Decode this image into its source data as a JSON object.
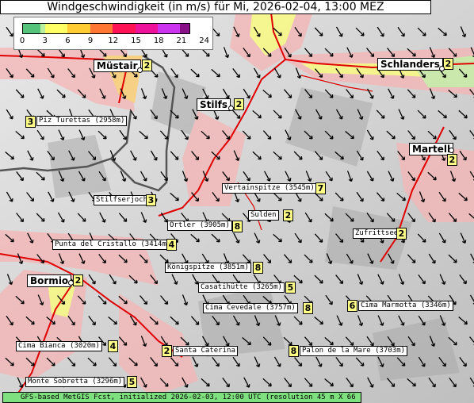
{
  "title": "Windgeschwindigkeit (in m/s) für Mi, 2026-02-04, 13:00 MEZ",
  "legend": {
    "colors": [
      "#55c47a",
      "#b9f0a0",
      "#ffff66",
      "#ffcc33",
      "#ff7733",
      "#ff1155",
      "#ee1199",
      "#cc33ee",
      "#881188"
    ],
    "ticks": [
      "0",
      "3",
      "6",
      "9",
      "12",
      "15",
      "18",
      "21",
      "24"
    ]
  },
  "towns": [
    {
      "name": "Müstair",
      "value": "2"
    },
    {
      "name": "Schlanders",
      "value": "2"
    },
    {
      "name": "Stilfs",
      "value": "2"
    },
    {
      "name": "Martell",
      "value": "2"
    },
    {
      "name": "Bormio",
      "value": "2"
    }
  ],
  "places": [
    {
      "name": "Piz Turettas (2958m)",
      "value": "3"
    },
    {
      "name": "Vertainspitze (3545m)",
      "value": "7"
    },
    {
      "name": "Stilfserjoch",
      "value": "3"
    },
    {
      "name": "Sulden",
      "value": "2"
    },
    {
      "name": "Ortler (3905m)",
      "value": "8"
    },
    {
      "name": "Zufrittsee",
      "value": "2"
    },
    {
      "name": "Punta del Cristallo (3414m)",
      "value": "4"
    },
    {
      "name": "Königspitze (3851m)",
      "value": "8"
    },
    {
      "name": "Casatihütte (3265m)",
      "value": "5"
    },
    {
      "name": "Cima Cevedale (3757m)",
      "value": "8"
    },
    {
      "name": "Cima Marmotta (3346m)",
      "value": "6"
    },
    {
      "name": "Cima Bianca (3020m)",
      "value": "4"
    },
    {
      "name": "Santa Caterina",
      "value": "2"
    },
    {
      "name": "Palon de la Mare (3703m)",
      "value": "8"
    },
    {
      "name": "Monte Sobretta (3296m)",
      "value": "5"
    }
  ],
  "footer": "GFS-based MetGIS Fcst, initialized 2026-02-03, 12:00 UTC  (resolution 45 m X 66 m)"
}
